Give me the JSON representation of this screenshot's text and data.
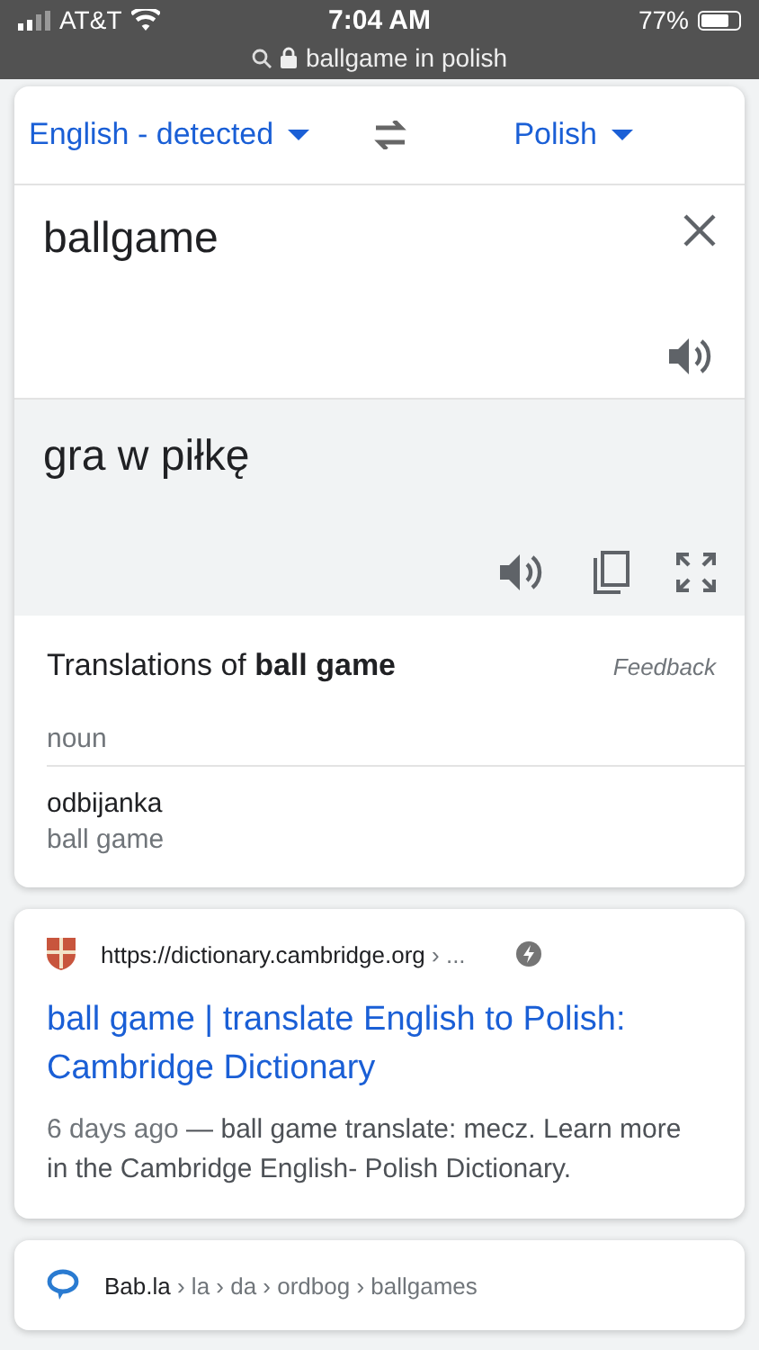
{
  "status_bar": {
    "carrier": "AT&T",
    "time": "7:04 AM",
    "battery": "77%",
    "url": "ballgame in polish"
  },
  "translator": {
    "source_language": "English - detected",
    "target_language": "Polish",
    "source_text": "ballgame",
    "translation": "gra w piłkę",
    "dictionary": {
      "title": "Translations of **ball game**",
      "feedback": "Feedback",
      "part_of_speech": "noun",
      "entries": [
        {
          "word": "odbijanka",
          "meaning": "ball game"
        }
      ]
    }
  },
  "results": [
    {
      "kind": "cambridge",
      "site": "https://dictionary.cambridge.org",
      "path": " › ...",
      "amp": true,
      "title": "ball game | translate English to Polish: Cambridge Dictionary",
      "date": "6 days ago",
      "snippet": " — ball game translate: mecz. Learn more in the Cambridge English- Polish Dictionary."
    },
    {
      "kind": "babla",
      "site": "Bab.la",
      "path": " › la › da › ordbog › ballgames",
      "amp": false
    }
  ]
}
